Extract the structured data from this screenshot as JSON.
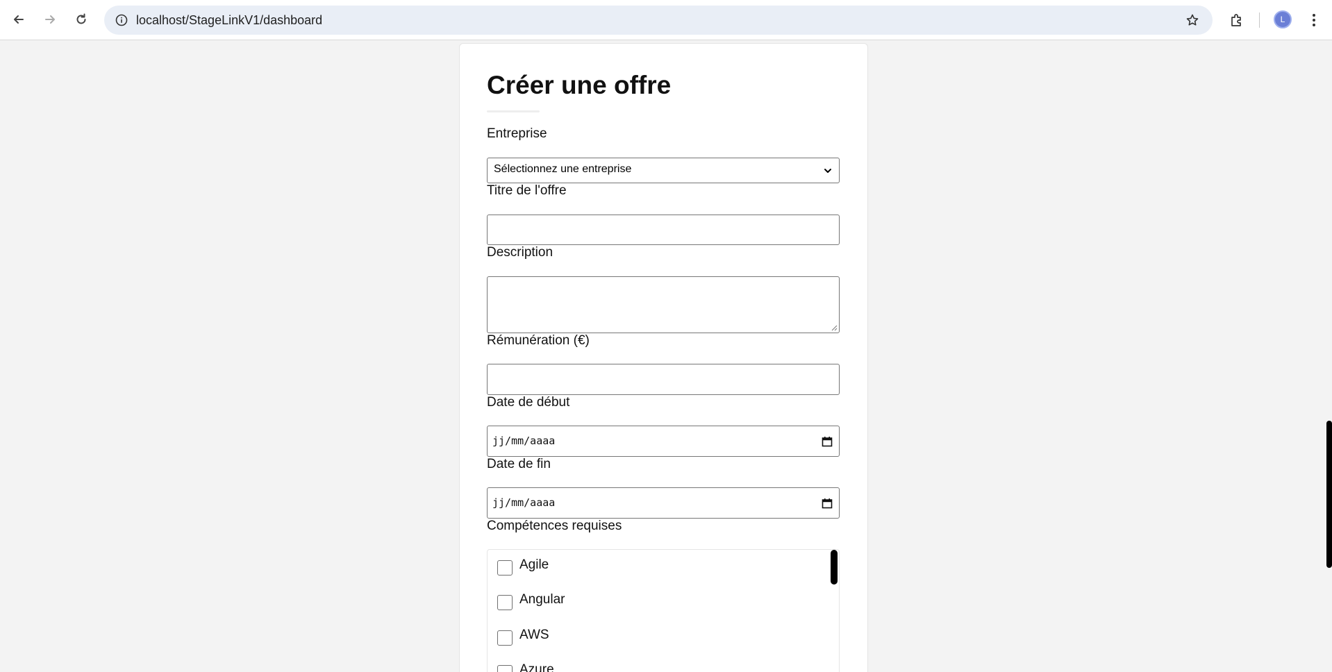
{
  "browser": {
    "url": "localhost/StageLinkV1/dashboard",
    "avatar_letter": "L",
    "icons": [
      "back-arrow-icon",
      "forward-arrow-icon",
      "reload-icon",
      "site-info-icon",
      "bookmark-star-icon",
      "extensions-icon",
      "profile-avatar",
      "kebab-menu-icon"
    ]
  },
  "form": {
    "title": "Créer une offre",
    "company_label": "Entreprise",
    "company_select_value": "Sélectionnez une entreprise",
    "offer_title_label": "Titre de l'offre",
    "offer_title_value": "",
    "description_label": "Description",
    "description_value": "",
    "salary_label": "Rémunération (€)",
    "salary_value": "",
    "start_date_label": "Date de début",
    "start_date_placeholder": "jj/mm/aaaa",
    "end_date_label": "Date de fin",
    "end_date_placeholder": "jj/mm/aaaa",
    "skills_label": "Compétences requises",
    "skills": [
      {
        "label": "Agile",
        "checked": false
      },
      {
        "label": "Angular",
        "checked": false
      },
      {
        "label": "AWS",
        "checked": false
      },
      {
        "label": "Azure",
        "checked": false
      }
    ]
  },
  "colors": {
    "page_bg": "#f3f3f3",
    "card_bg": "#ffffff",
    "omnibox_bg": "#e9eef6",
    "avatar_bg": "#6b7fd6"
  }
}
